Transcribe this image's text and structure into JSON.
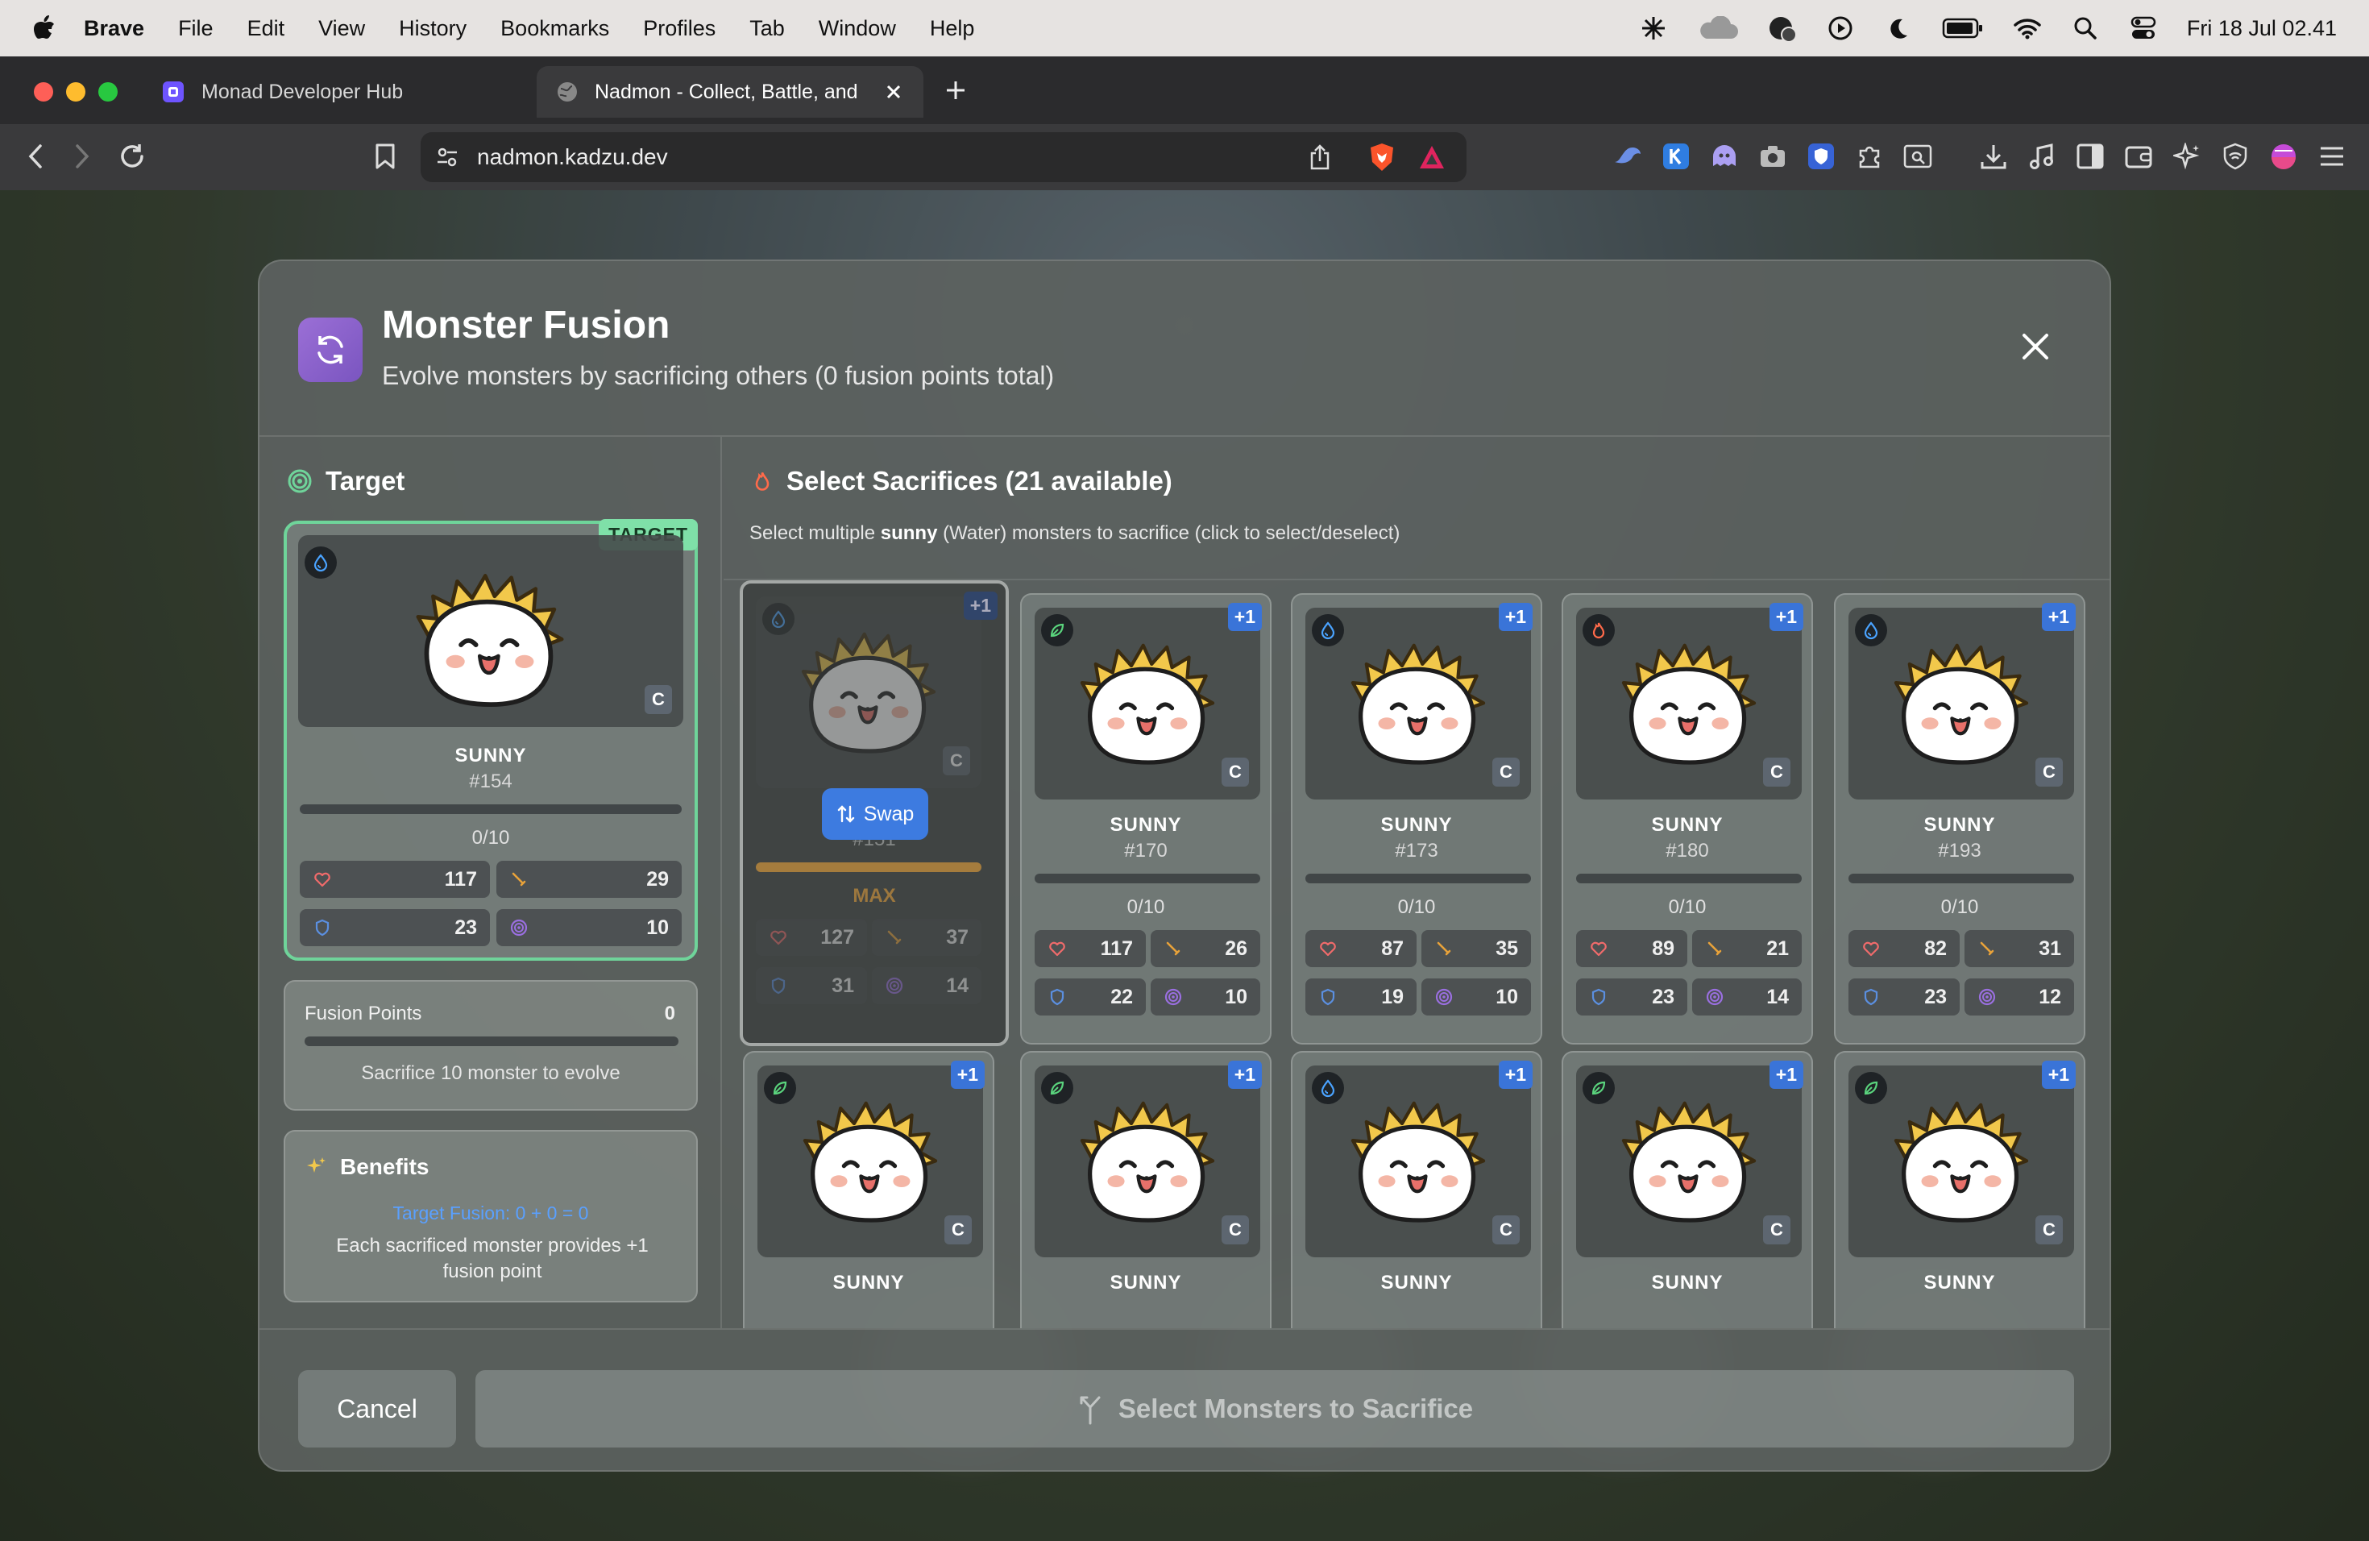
{
  "menubar": {
    "app": "Brave",
    "items": [
      "File",
      "Edit",
      "View",
      "History",
      "Bookmarks",
      "Profiles",
      "Tab",
      "Window",
      "Help"
    ],
    "datetime": "Fri 18 Jul  02.41"
  },
  "browser": {
    "tabs": [
      {
        "title": "Monad Developer Hub"
      },
      {
        "title": "Nadmon - Collect, Battle, and"
      }
    ],
    "url": "nadmon.kadzu.dev"
  },
  "modal": {
    "title": "Monster Fusion",
    "subtitle": "Evolve monsters by sacrificing others (0 fusion points total)",
    "target_heading": "Target",
    "target": {
      "badge": "TARGET",
      "name": "SUNNY",
      "number": "#154",
      "rarity": "C",
      "progress_text": "0/10",
      "progress": 0,
      "hp": "117",
      "attack": "29",
      "defense": "23",
      "crit": "10"
    },
    "fusion_points": {
      "label": "Fusion Points",
      "value": "0",
      "hint": "Sacrifice 10 monster to evolve"
    },
    "benefits": {
      "title": "Benefits",
      "formula": "Target Fusion: 0 + 0 = 0",
      "description": "Each sacrificed monster provides +1 fusion point"
    },
    "sacrifice_heading": "Select Sacrifices (21 available)",
    "instruction_prefix": "Select multiple ",
    "instruction_name": "sunny",
    "instruction_suffix": " (Water) monsters to sacrifice (click to select/deselect)",
    "swap_label": "Swap",
    "cards_row1": [
      {
        "name": "SUNNY",
        "number": "#151",
        "element": "water",
        "rarity": "C",
        "plus": "+1",
        "progress_text": "MAX",
        "progress": 1,
        "hp": "127",
        "attack": "37",
        "defense": "31",
        "crit": "14",
        "selected": true
      },
      {
        "name": "SUNNY",
        "number": "#170",
        "element": "nature",
        "rarity": "C",
        "plus": "+1",
        "progress_text": "0/10",
        "progress": 0,
        "hp": "117",
        "attack": "26",
        "defense": "22",
        "crit": "10"
      },
      {
        "name": "SUNNY",
        "number": "#173",
        "element": "water",
        "rarity": "C",
        "plus": "+1",
        "progress_text": "0/10",
        "progress": 0,
        "hp": "87",
        "attack": "35",
        "defense": "19",
        "crit": "10"
      },
      {
        "name": "SUNNY",
        "number": "#180",
        "element": "fire",
        "rarity": "C",
        "plus": "+1",
        "progress_text": "0/10",
        "progress": 0,
        "hp": "89",
        "attack": "21",
        "defense": "23",
        "crit": "14"
      },
      {
        "name": "SUNNY",
        "number": "#193",
        "element": "water",
        "rarity": "C",
        "plus": "+1",
        "progress_text": "0/10",
        "progress": 0,
        "hp": "82",
        "attack": "31",
        "defense": "23",
        "crit": "12"
      }
    ],
    "cards_row2": [
      {
        "name": "SUNNY",
        "element": "nature",
        "rarity": "C",
        "plus": "+1"
      },
      {
        "name": "SUNNY",
        "element": "nature",
        "rarity": "C",
        "plus": "+1"
      },
      {
        "name": "SUNNY",
        "element": "water",
        "rarity": "C",
        "plus": "+1"
      },
      {
        "name": "SUNNY",
        "element": "nature",
        "rarity": "C",
        "plus": "+1"
      },
      {
        "name": "SUNNY",
        "element": "nature",
        "rarity": "C",
        "plus": "+1"
      }
    ],
    "cancel_label": "Cancel",
    "submit_label": "Select Monsters to Sacrifice"
  },
  "colors": {
    "accent": "#3d7be0",
    "target_border": "#6fd49a",
    "max_bar": "#e8a23a",
    "hp": "#f06b6b",
    "attack": "#e8a23a",
    "defense": "#5b8fe0",
    "crit": "#9a6fe0"
  }
}
